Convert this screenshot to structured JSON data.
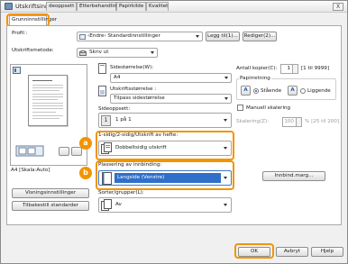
{
  "window": {
    "title": "Utskriftsinnstillinger",
    "close": "X"
  },
  "tabs": [
    "Grunninnstillinger",
    "deoppsett",
    "Etterbehandling",
    "Papirkilde",
    "Kvalitet"
  ],
  "profile": {
    "label": "Profil :",
    "value": "‹Endre› Standardinnstillinger",
    "add_button": "Legg til(1)...",
    "edit_button": "Rediger(2)..."
  },
  "output_method": {
    "label": "Utskriftsmetode:",
    "value": "Skriv ut"
  },
  "page_size": {
    "label": "Sidestørrelse(W):",
    "value": "A4"
  },
  "output_size": {
    "label": "Utskriftsstørrelse :",
    "value": "Tilpass sidestørrelse"
  },
  "page_layout": {
    "label": "Sideoppsett:",
    "value": "1 på 1",
    "page_number": "1"
  },
  "copies": {
    "label": "Antall kopier(C):",
    "value": "1",
    "range": "[1 til 9999]"
  },
  "orientation": {
    "label": "Papirretning",
    "portrait": "Stående",
    "landscape": "Liggende",
    "portrait_letter": "A",
    "landscape_letter": "A"
  },
  "manual_scaling": {
    "label": "Manuell skalering",
    "scaling_label": "Skalering(Z):",
    "value": "100",
    "range": "% [25 til 200]"
  },
  "duplex": {
    "label": "1-sidig/2-sidig/Utskrift av hefte:",
    "value": "Dobbeltsidig utskrift",
    "badge": "a"
  },
  "binding": {
    "label": "Plassering av innbinding:",
    "value": "Langside (Venstre)",
    "badge": "b",
    "margin_button": "Innbind.marg..."
  },
  "sorting": {
    "label": "Sorter/grupper(L):",
    "value": "Av"
  },
  "preview": {
    "caption": "A4 [Skala:Auto]"
  },
  "left_buttons": {
    "view_settings": "Visningsinnstillinger",
    "restore_defaults": "Tilbakestill standarder"
  },
  "footer": {
    "ok": "OK",
    "cancel": "Avbryt",
    "help": "Hjelp"
  },
  "colors": {
    "highlight": "#f29400",
    "accent": "#1c5ab4"
  }
}
